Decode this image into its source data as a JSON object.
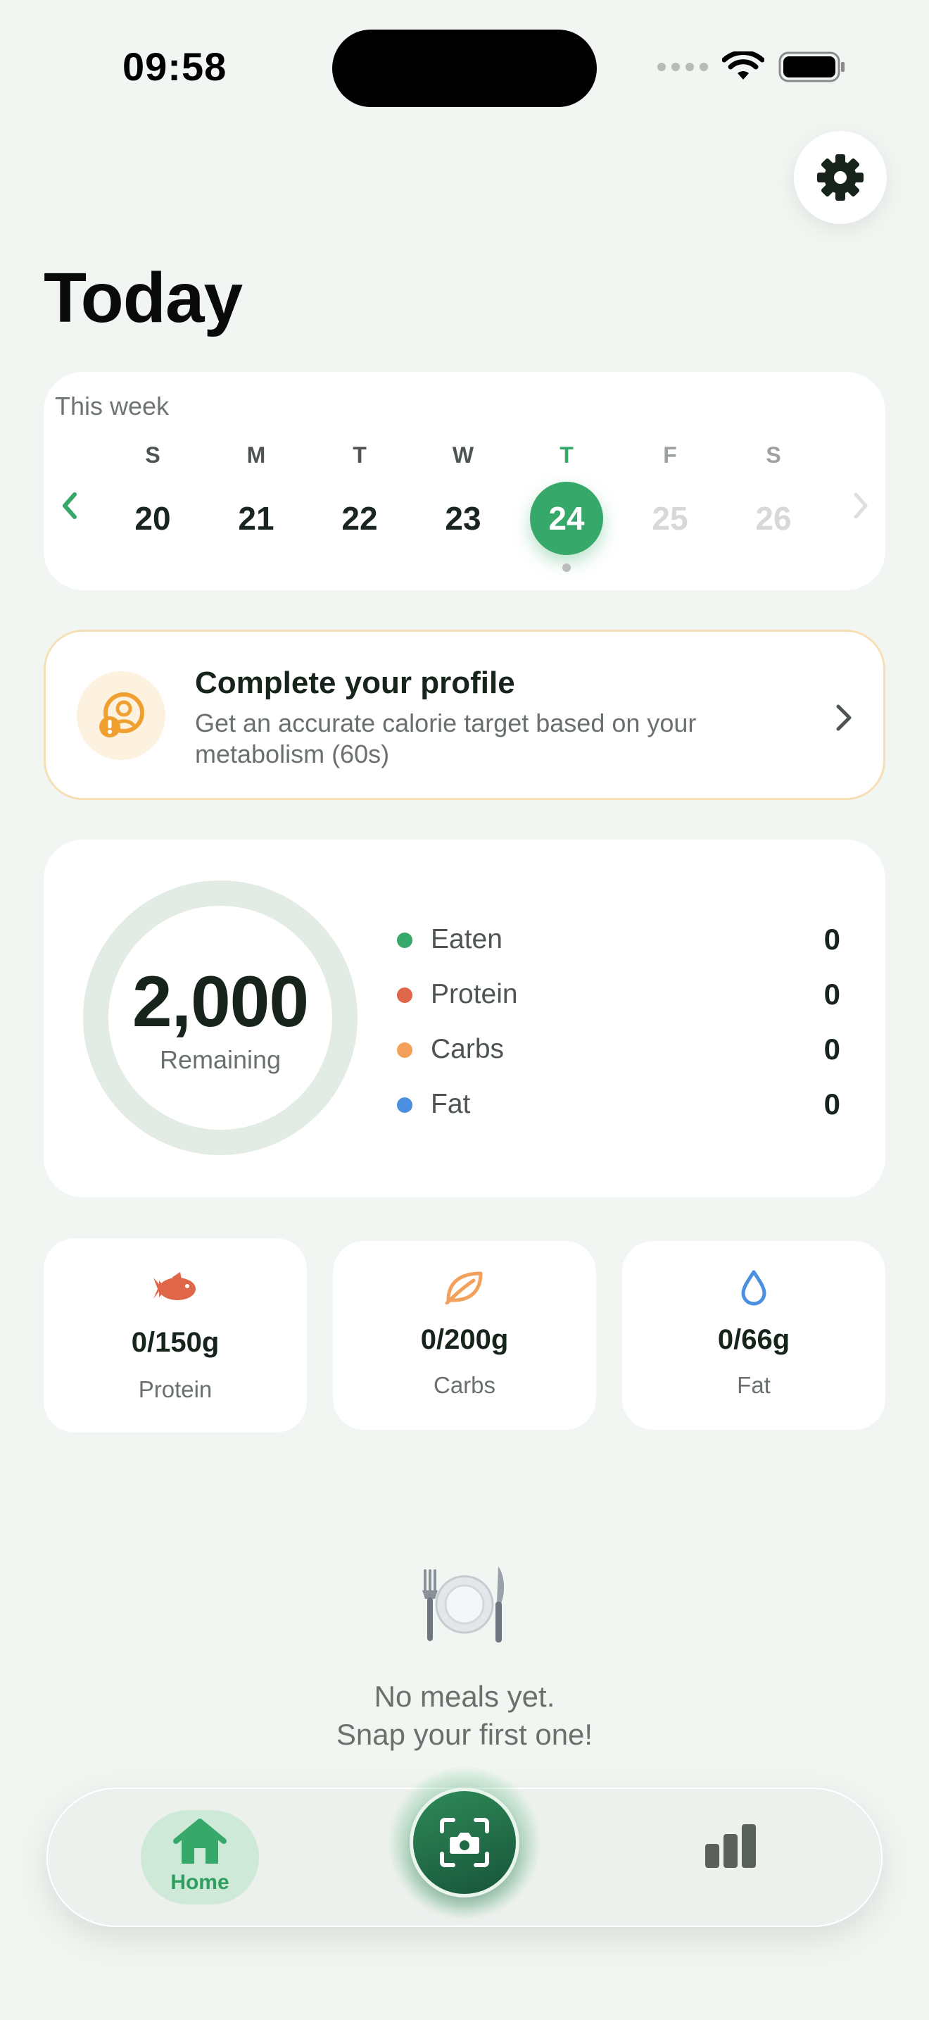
{
  "status_bar": {
    "time": "09:58"
  },
  "header": {
    "title": "Today"
  },
  "week": {
    "label": "This week",
    "days": [
      {
        "letter": "S",
        "number": "20",
        "state": "past"
      },
      {
        "letter": "M",
        "number": "21",
        "state": "past"
      },
      {
        "letter": "T",
        "number": "22",
        "state": "past"
      },
      {
        "letter": "W",
        "number": "23",
        "state": "past"
      },
      {
        "letter": "T",
        "number": "24",
        "state": "selected"
      },
      {
        "letter": "F",
        "number": "25",
        "state": "future"
      },
      {
        "letter": "S",
        "number": "26",
        "state": "future"
      }
    ]
  },
  "profile_banner": {
    "title": "Complete your profile",
    "description": "Get an accurate calorie target based on your metabolism (60s)"
  },
  "calories": {
    "remaining_value": "2,000",
    "remaining_label": "Remaining",
    "rows": [
      {
        "label": "Eaten",
        "value": "0",
        "color": "#36a869"
      },
      {
        "label": "Protein",
        "value": "0",
        "color": "#e0664a"
      },
      {
        "label": "Carbs",
        "value": "0",
        "color": "#f2a05a"
      },
      {
        "label": "Fat",
        "value": "0",
        "color": "#4a8fe0"
      }
    ]
  },
  "macros": [
    {
      "value": "0/150g",
      "label": "Protein",
      "icon": "fish-icon",
      "color": "#e0664a"
    },
    {
      "value": "0/200g",
      "label": "Carbs",
      "icon": "leaf-icon",
      "color": "#f2a05a"
    },
    {
      "value": "0/66g",
      "label": "Fat",
      "icon": "drop-icon",
      "color": "#4a8fe0"
    }
  ],
  "empty_state": {
    "line1": "No meals yet.",
    "line2": "Snap your first one!",
    "icon": "plate-cutlery-icon"
  },
  "tabbar": {
    "home_label": "Home",
    "accent": "#36a869"
  }
}
